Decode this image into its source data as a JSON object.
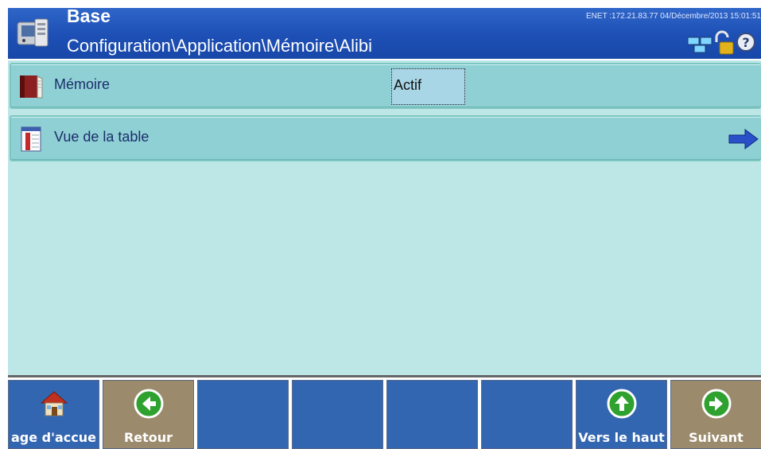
{
  "header": {
    "title": "Base",
    "path": "Configuration\\Application\\Mémoire\\Alibi",
    "status": "ENET :172.21.83.77  04/Décembre/2013 15:01:51",
    "icons": [
      "network-icon",
      "lock-open-icon",
      "help-icon"
    ]
  },
  "rows": [
    {
      "label": "Mémoire",
      "value": "Actif",
      "icon": "book-icon"
    },
    {
      "label": "Vue de la table",
      "icon": "table-view-icon",
      "action_icon": "arrow-right-icon"
    }
  ],
  "softkeys": [
    {
      "label": "age d'accue",
      "icon": "home-icon",
      "color": "#3366b0"
    },
    {
      "label": "Retour",
      "icon": "arrow-left-icon",
      "color": "#9b8a6b"
    },
    {
      "label": "",
      "color": "#3366b0"
    },
    {
      "label": "",
      "color": "#3366b0"
    },
    {
      "label": "",
      "color": "#3366b0"
    },
    {
      "label": "",
      "color": "#3366b0"
    },
    {
      "label": "Vers le haut",
      "icon": "arrow-up-icon",
      "color": "#3366b0"
    },
    {
      "label": "Suivant",
      "icon": "arrow-right-icon",
      "color": "#9b8a6b"
    }
  ],
  "colors": {
    "header": "#1d4fb5",
    "main_bg": "#bde6e6",
    "row_bg": "#8fd0d5"
  }
}
